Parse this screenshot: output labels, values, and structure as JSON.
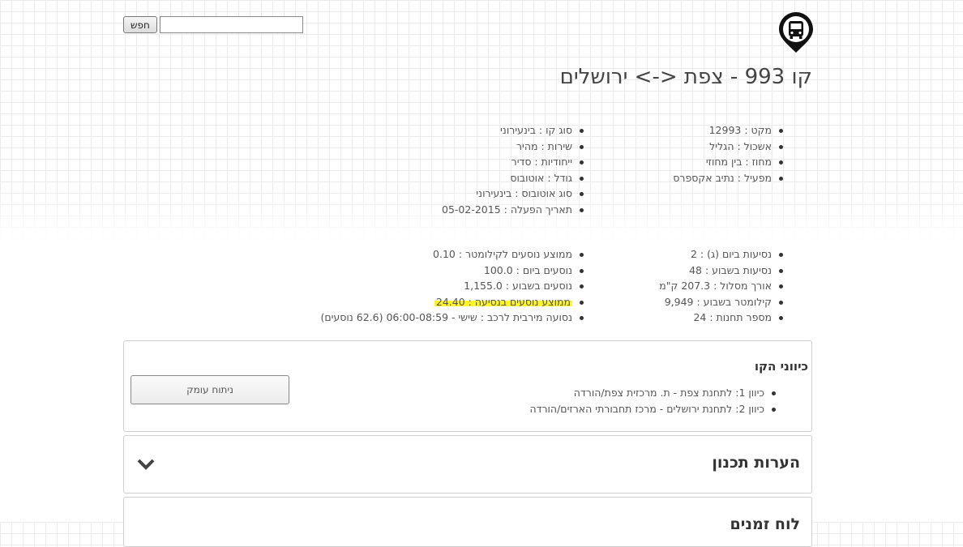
{
  "search": {
    "button_label": "חפש",
    "input_value": ""
  },
  "page": {
    "title": "קו 993 - צפת <-> ירושלים"
  },
  "details_right": [
    "מקט : 12993",
    "אשכול : הגליל",
    "מחוז : בין מחוזי",
    "מפעיל : נתיב אקספרס"
  ],
  "details_left": [
    "סוג קו : בינעירוני",
    "שירות : מהיר",
    "ייחודיות : סדיר",
    "גודל : אוטובוס",
    "סוג אוטובוס : בינעירוני",
    "תאריך הפעלה : 05-02-2015"
  ],
  "stats_right": [
    "נסיעות ביום (ג) : 2",
    "נסיעות בשבוע : 48",
    "אורך מסלול : 207.3 ק\"מ",
    "קילומטר בשבוע : 9,949",
    "מספר תחנות : 24"
  ],
  "stats_left": [
    "ממוצע נוסעים לקילומטר : 0.10",
    "נוסעים ביום : 100.0",
    "נוסעים בשבוע : 1,155.0",
    "ממוצע נוסעים בנסיעה : 24.40",
    "נסועה מירבית לרכב : שישי - 06:00-08:59 (62.6 נוסעים)"
  ],
  "directions_panel": {
    "heading": "כיווני הקו",
    "items": [
      "כיוון 1: לתחנת צפת - ת. מרכזית צפת/הורדה",
      "כיוון 2: לתחנת ירושלים - מרכז תחבורתי הארזים/הורדה"
    ],
    "deep_analysis_label": "ניתוח עומק"
  },
  "planning_panel": {
    "heading": "הערות תכנון"
  },
  "third_panel": {
    "heading": "לוח זמנים"
  },
  "colors": {
    "highlight": "#fff52b",
    "logo": "#111111"
  },
  "icons": {
    "logo": "bus-stop-pin-icon",
    "expand": "chevron-down-icon"
  }
}
